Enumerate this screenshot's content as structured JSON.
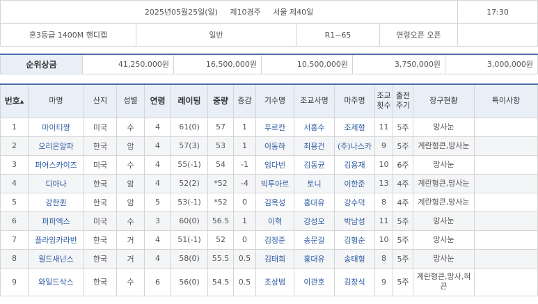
{
  "race_info": {
    "date_round": "2025년05월25일(일)     제10경주     서울 제40일",
    "time": "17:30",
    "grade_distance": "혼3등급  1400M  핸디캡",
    "race_type": "일반",
    "rating_range": "R1~65",
    "age_condition": "연령오픈 오픈"
  },
  "prize": {
    "label": "순위상금",
    "values": [
      "41,250,000원",
      "16,500,000원",
      "10,500,000원",
      "3,750,000원",
      "3,000,000원"
    ]
  },
  "horse_table": {
    "headers": {
      "no": "번호",
      "name": "마명",
      "origin": "산지",
      "sex": "성별",
      "age": "연령",
      "rating": "레이팅",
      "weight": "중량",
      "weight_change": "증감",
      "jockey": "기수명",
      "trainer": "조교사명",
      "owner": "마주명",
      "training_count": "조교 횟수",
      "interval": "출전 주기",
      "equipment": "장구현황",
      "notes": "특이사항"
    },
    "sort_glyph": "▲",
    "rows": [
      {
        "no": "1",
        "name": "마이티쨩",
        "origin": "미국",
        "sex": "수",
        "age": "4",
        "rating": "61(0)",
        "weight": "57",
        "weight_change": "1",
        "jockey": "푸르칸",
        "trainer": "서홍수",
        "owner": "조제형",
        "training_count": "11",
        "interval": "5주",
        "equipment": "망사눈",
        "notes": ""
      },
      {
        "no": "2",
        "name": "오리온알파",
        "origin": "한국",
        "sex": "암",
        "age": "4",
        "rating": "57(3)",
        "weight": "53",
        "weight_change": "1",
        "jockey": "이동하",
        "trainer": "최용건",
        "owner": "(주)나스카",
        "training_count": "9",
        "interval": "5주",
        "equipment": "계란형큰,망사눈",
        "notes": ""
      },
      {
        "no": "3",
        "name": "퍼어스카이즈",
        "origin": "미국",
        "sex": "수",
        "age": "4",
        "rating": "55(-1)",
        "weight": "54",
        "weight_change": "-1",
        "jockey": "임다빈",
        "trainer": "김동균",
        "owner": "김용재",
        "training_count": "10",
        "interval": "6주",
        "equipment": "망사눈",
        "notes": ""
      },
      {
        "no": "4",
        "name": "디아나",
        "origin": "한국",
        "sex": "암",
        "age": "4",
        "rating": "52(2)",
        "weight": "*52",
        "weight_change": "-4",
        "jockey": "빅투아르",
        "trainer": "토니",
        "owner": "이한준",
        "training_count": "13",
        "interval": "4주",
        "equipment": "계란형큰,망사눈",
        "notes": ""
      },
      {
        "no": "5",
        "name": "강한퀸",
        "origin": "한국",
        "sex": "암",
        "age": "5",
        "rating": "53(-1)",
        "weight": "*52",
        "weight_change": "0",
        "jockey": "김옥성",
        "trainer": "홍대유",
        "owner": "강수덕",
        "training_count": "8",
        "interval": "4주",
        "equipment": "계란형큰,망사눈",
        "notes": ""
      },
      {
        "no": "6",
        "name": "퍼퍼엑스",
        "origin": "미국",
        "sex": "수",
        "age": "3",
        "rating": "60(0)",
        "weight": "56.5",
        "weight_change": "1",
        "jockey": "이혁",
        "trainer": "강성오",
        "owner": "박남성",
        "training_count": "11",
        "interval": "5주",
        "equipment": "망사눈",
        "notes": ""
      },
      {
        "no": "7",
        "name": "플라잉카라반",
        "origin": "한국",
        "sex": "거",
        "age": "4",
        "rating": "51(-1)",
        "weight": "52",
        "weight_change": "0",
        "jockey": "김정준",
        "trainer": "송문길",
        "owner": "김형순",
        "training_count": "10",
        "interval": "5주",
        "equipment": "망사눈",
        "notes": ""
      },
      {
        "no": "8",
        "name": "월드새넌스",
        "origin": "한국",
        "sex": "거",
        "age": "4",
        "rating": "58(0)",
        "weight": "55.5",
        "weight_change": "0.5",
        "jockey": "김태희",
        "trainer": "홍대유",
        "owner": "송태형",
        "training_count": "8",
        "interval": "5주",
        "equipment": "망사눈",
        "notes": ""
      },
      {
        "no": "9",
        "name": "와일드삭스",
        "origin": "한국",
        "sex": "수",
        "age": "6",
        "rating": "56(0)",
        "weight": "54.5",
        "weight_change": "0.5",
        "jockey": "조상범",
        "trainer": "이관호",
        "owner": "김창식",
        "training_count": "9",
        "interval": "5주",
        "equipment": "계란형큰,망사,혀끈",
        "notes": ""
      }
    ]
  }
}
